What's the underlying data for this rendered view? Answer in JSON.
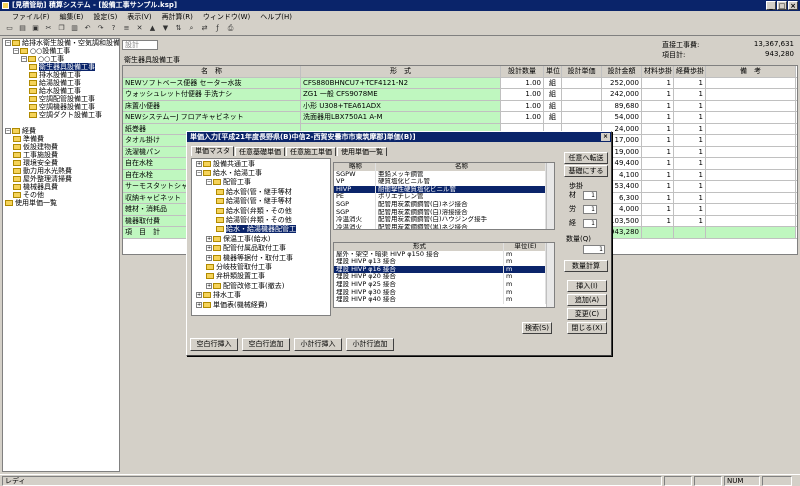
{
  "window": {
    "title": "[見積管助] 積算システム - [設備工事サンプル.ksp]"
  },
  "menu": [
    "ファイル(F)",
    "編集(E)",
    "設定(S)",
    "表示(V)",
    "再計算(R)",
    "ウィンドウ(W)",
    "ヘルプ(H)"
  ],
  "tree": [
    {
      "label": "給排水衛生設備・空気調和設備",
      "level": 0,
      "pm": "−"
    },
    {
      "label": "○○設備工事",
      "level": 1,
      "pm": "−"
    },
    {
      "label": "○○工事",
      "level": 2,
      "pm": "−"
    },
    {
      "label": "衛生器具設備工事",
      "level": 3,
      "sel": true
    },
    {
      "label": "排水設備工事",
      "level": 3
    },
    {
      "label": "給湯設備工事",
      "level": 3
    },
    {
      "label": "給水設備工事",
      "level": 3
    },
    {
      "label": "空調配管設備工事",
      "level": 3
    },
    {
      "label": "空調機器設備工事",
      "level": 3
    },
    {
      "label": "空調ダクト設備工事",
      "level": 3
    },
    {
      "label": "",
      "level": 0
    },
    {
      "label": "経費",
      "level": 0,
      "pm": "−"
    },
    {
      "label": "準備費",
      "level": 1
    },
    {
      "label": "仮設建物費",
      "level": 1
    },
    {
      "label": "工事施設費",
      "level": 1
    },
    {
      "label": "環境安全費",
      "level": 1
    },
    {
      "label": "動力用水光熱費",
      "level": 1
    },
    {
      "label": "屋外整理清掃費",
      "level": 1
    },
    {
      "label": "機械器具費",
      "level": 1
    },
    {
      "label": "その他",
      "level": 1
    },
    {
      "label": "使用単価一覧",
      "level": 0
    }
  ],
  "main": {
    "filter_label": "設計",
    "section_title": "衛生器具設備工事",
    "direct_cost_label": "直接工事費:",
    "direct_cost_value": "13,367,631",
    "item_total_label": "項目計:",
    "item_total_value": "943,280",
    "columns": [
      "名　称",
      "形　式",
      "設計数量",
      "単位",
      "設計単価",
      "設計金額",
      "材料歩掛",
      "経費歩掛",
      "備　考"
    ],
    "rows": [
      {
        "name": "NEWソフトベース便器 セーター水抜",
        "form": "CFS880BHNCU7+TCF4121-N2",
        "qty": "1.00",
        "unit": "組",
        "price": "",
        "amount": "252,000",
        "mat": "1",
        "exp": "1",
        "note": ""
      },
      {
        "name": "ウォッシュレット付便器 手洗ナシ",
        "form": "ZG1 一般 CFS9078ME",
        "qty": "1.00",
        "unit": "組",
        "price": "",
        "amount": "242,000",
        "mat": "1",
        "exp": "1",
        "note": ""
      },
      {
        "name": "床置小便器",
        "form": "小形 U308+TEA61ADX",
        "qty": "1.00",
        "unit": "組",
        "price": "",
        "amount": "89,680",
        "mat": "1",
        "exp": "1",
        "note": ""
      },
      {
        "name": "NEWシステムーJ フロアキャビネット",
        "form": "洗面器用LBX750A1 A-M",
        "qty": "1.00",
        "unit": "組",
        "price": "",
        "amount": "54,000",
        "mat": "1",
        "exp": "1",
        "note": ""
      },
      {
        "name": "紙巻器",
        "form": "",
        "qty": "",
        "unit": "",
        "price": "",
        "amount": "24,000",
        "mat": "1",
        "exp": "1",
        "note": ""
      },
      {
        "name": "タオル掛け",
        "form": "",
        "qty": "",
        "unit": "",
        "price": "",
        "amount": "17,000",
        "mat": "1",
        "exp": "1",
        "note": ""
      },
      {
        "name": "洗濯機パン",
        "form": "",
        "qty": "",
        "unit": "",
        "price": "",
        "amount": "19,000",
        "mat": "1",
        "exp": "1",
        "note": ""
      },
      {
        "name": "自在水栓",
        "form": "",
        "qty": "",
        "unit": "",
        "price": "",
        "amount": "49,400",
        "mat": "1",
        "exp": "1",
        "note": ""
      },
      {
        "name": "自在水栓",
        "form": "",
        "qty": "",
        "unit": "",
        "price": "",
        "amount": "4,100",
        "mat": "1",
        "exp": "1",
        "note": ""
      },
      {
        "name": "サーモスタットシャワー金具 台",
        "form": "",
        "qty": "",
        "unit": "",
        "price": "",
        "amount": "53,400",
        "mat": "1",
        "exp": "1",
        "note": ""
      },
      {
        "name": "収納キャビネット",
        "form": "",
        "qty": "",
        "unit": "",
        "price": "",
        "amount": "6,300",
        "mat": "1",
        "exp": "1",
        "note": ""
      },
      {
        "name": "雑材・消耗品",
        "form": "",
        "qty": "",
        "unit": "",
        "price": "",
        "amount": "4,000",
        "mat": "1",
        "exp": "1",
        "note": ""
      },
      {
        "name": "機器取付費",
        "form": "",
        "qty": "",
        "unit": "",
        "price": "",
        "amount": "103,500",
        "mat": "1",
        "exp": "1",
        "note": ""
      }
    ],
    "total_row": {
      "label": "項　目　計",
      "amount": "943,280"
    }
  },
  "dialog": {
    "title": "単価入力[平成21年度長野県(B)中信2-西賀安曇市市東筑摩郡]単価(B)]",
    "close": "×",
    "tabs": [
      "単価マスタ",
      "任意基礎単価",
      "任意施工単価",
      "使用単価一覧"
    ],
    "tree": [
      {
        "label": "設備共通工事",
        "level": 0,
        "pm": "+"
      },
      {
        "label": "給水・給湯工事",
        "level": 0,
        "pm": "−"
      },
      {
        "label": "配管工事",
        "level": 1,
        "pm": "−"
      },
      {
        "label": "給水管(管・継手等材",
        "level": 2
      },
      {
        "label": "給湯管(管・継手等材",
        "level": 2
      },
      {
        "label": "給水管(弁類・その他",
        "level": 2
      },
      {
        "label": "給湯管(弁類・その他",
        "level": 2
      },
      {
        "label": "給水・給湯機器配管工",
        "level": 2,
        "sel": true
      },
      {
        "label": "保温工事(給水)",
        "level": 1,
        "pm": "+"
      },
      {
        "label": "配管付属品取付工事",
        "level": 1,
        "pm": "+"
      },
      {
        "label": "機器等据付・取付工事",
        "level": 1,
        "pm": "+"
      },
      {
        "label": "分岐枝管取付工事",
        "level": 1
      },
      {
        "label": "弁枡類設置工事",
        "level": 1
      },
      {
        "label": "配管改修工事(撤去)",
        "level": 1,
        "pm": "+"
      },
      {
        "label": "排水工事",
        "level": 0,
        "pm": "+"
      },
      {
        "label": "単価表(機械経費)",
        "level": 0,
        "pm": "+"
      }
    ],
    "upper_cols": [
      "略称",
      "名称"
    ],
    "upper_rows": [
      {
        "a": "SGPW",
        "b": "亜鉛メッキ鋼管",
        "sel": false
      },
      {
        "a": "VP",
        "b": "硬質塩化ビニル管",
        "sel": false
      },
      {
        "a": "HIVP",
        "b": "耐衝撃性硬質塩化ビニル管",
        "sel": true
      },
      {
        "a": "PE",
        "b": "ポリエチレン管",
        "sel": false
      },
      {
        "a": "SGP",
        "b": "配管用炭素鋼鋼管(白)ネジ接合",
        "sel": false
      },
      {
        "a": "SGP",
        "b": "配管用炭素鋼鋼管(白)溶接接合",
        "sel": false
      },
      {
        "a": "冷温消火",
        "b": "配管用炭素鋼鋼管(白)ハウジング接手",
        "sel": false
      },
      {
        "a": "冷温消火",
        "b": "配管用炭素鋼鋼管(黒)ネジ接合",
        "sel": false
      }
    ],
    "lower_cols": [
      "形式",
      "単位(E)"
    ],
    "lower_rows": [
      {
        "a": "屋外・架空・暗渠 HIVP φ150 接合",
        "b": "m",
        "sel": false
      },
      {
        "a": "埋設 HIVP φ13 接合",
        "b": "m",
        "sel": false
      },
      {
        "a": "埋設 HIVP φ16 接合",
        "b": "m",
        "sel": true
      },
      {
        "a": "埋設 HIVP φ20 接合",
        "b": "m",
        "sel": false
      },
      {
        "a": "埋設 HIVP φ25 接合",
        "b": "m",
        "sel": false
      },
      {
        "a": "埋設 HIVP φ30 接合",
        "b": "m",
        "sel": false
      },
      {
        "a": "埋設 HIVP φ40 接合",
        "b": "m",
        "sel": false
      }
    ],
    "search_btn": "検索(S)",
    "transfer_btn": "任意へ転送",
    "basic_btn": "基礎にする",
    "rate_label": "歩掛",
    "mat_label": "材",
    "mat_val": "1",
    "labor_label": "労",
    "labor_val": "1",
    "exp_label": "経",
    "exp_val": "1",
    "qty_label": "数量(Q)",
    "qty_val": "1",
    "calc_btn": "数量計算",
    "insert_btn": "挿入(I)",
    "add_btn": "追加(A)",
    "change_btn": "変更(C)",
    "close_btn": "閉じる(X)"
  },
  "bottom_buttons": [
    "空白行挿入",
    "空白行追加",
    "小計行挿入",
    "小計行追加"
  ],
  "status": {
    "text": "レディ",
    "num": "NUM"
  }
}
